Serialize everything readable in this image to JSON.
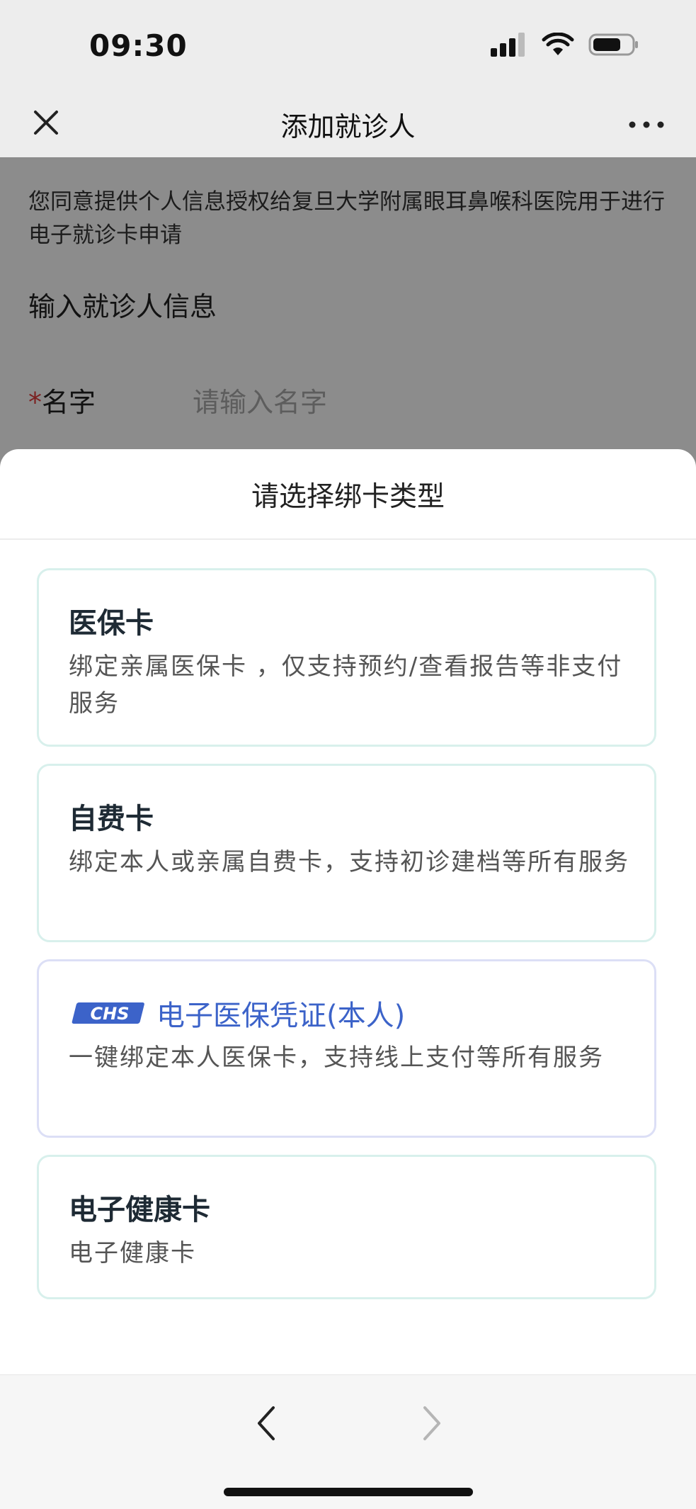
{
  "status_bar": {
    "time": "09:30"
  },
  "nav": {
    "title": "添加就诊人"
  },
  "form": {
    "consent_text": "您同意提供个人信息授权给复旦大学附属眼耳鼻喉科医院用于进行电子就诊卡申请",
    "section_title": "输入就诊人信息",
    "name_required_mark": "*",
    "name_label": "名字",
    "name_placeholder": "请输入名字"
  },
  "sheet": {
    "title": "请选择绑卡类型",
    "cards": [
      {
        "title": "医保卡",
        "desc": "绑定亲属医保卡 ，仅支持预约/查看报告等非支付服务"
      },
      {
        "title": "自费卡",
        "desc": "绑定本人或亲属自费卡，支持初诊建档等所有服务"
      },
      {
        "logo_text": "CHS",
        "title": "电子医保凭证(本人)",
        "desc": "一键绑定本人医保卡，支持线上支付等所有服务"
      },
      {
        "title": "电子健康卡",
        "desc": "电子健康卡"
      }
    ]
  },
  "colors": {
    "accent_blue": "#3c63c9",
    "required_red": "#e23c3c",
    "card_border": "#d8f0ec"
  },
  "icons": {
    "close": "close-icon",
    "more": "more-icon",
    "back": "chevron-left-icon",
    "forward": "chevron-right-icon",
    "signal": "signal-icon",
    "wifi": "wifi-icon",
    "battery": "battery-icon"
  }
}
